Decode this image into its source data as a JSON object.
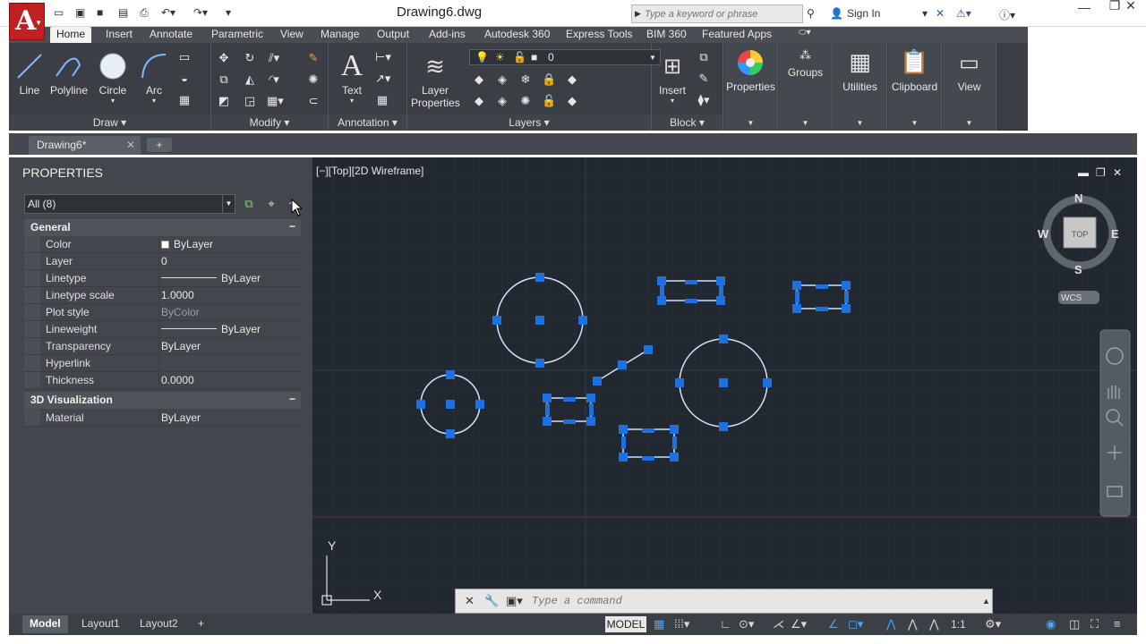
{
  "titlebar": {
    "document_title": "Drawing6.dwg",
    "search_placeholder": "Type a keyword or phrase",
    "sign_in": "Sign In"
  },
  "ribbon": {
    "tabs": [
      "Home",
      "Insert",
      "Annotate",
      "Parametric",
      "View",
      "Manage",
      "Output",
      "Add-ins",
      "Autodesk 360",
      "Express Tools",
      "BIM 360",
      "Featured Apps"
    ],
    "active_tab": "Home",
    "draw": {
      "line": "Line",
      "polyline": "Polyline",
      "circle": "Circle",
      "arc": "Arc",
      "panel": "Draw"
    },
    "modify": {
      "panel": "Modify"
    },
    "annotation": {
      "text": "Text",
      "panel": "Annotation"
    },
    "layers": {
      "layer_properties_1": "Layer",
      "layer_properties_2": "Properties",
      "current_layer": "0",
      "panel": "Layers"
    },
    "block": {
      "insert": "Insert",
      "panel": "Block"
    },
    "properties": "Properties",
    "groups": "Groups",
    "utilities": "Utilities",
    "clipboard": "Clipboard",
    "view": "View"
  },
  "filetabs": {
    "current": "Drawing6*"
  },
  "properties_palette": {
    "title": "PROPERTIES",
    "selection": "All (8)",
    "sections": {
      "general": "General",
      "viz3d": "3D Visualization"
    },
    "general_rows": [
      {
        "name": "Color",
        "value": "ByLayer"
      },
      {
        "name": "Layer",
        "value": "0"
      },
      {
        "name": "Linetype",
        "value": "ByLayer"
      },
      {
        "name": "Linetype scale",
        "value": "1.0000"
      },
      {
        "name": "Plot style",
        "value": "ByColor"
      },
      {
        "name": "Lineweight",
        "value": "ByLayer"
      },
      {
        "name": "Transparency",
        "value": "ByLayer"
      },
      {
        "name": "Hyperlink",
        "value": ""
      },
      {
        "name": "Thickness",
        "value": "0.0000"
      }
    ],
    "viz_rows": [
      {
        "name": "Material",
        "value": "ByLayer"
      }
    ]
  },
  "viewport": {
    "label": "[−][Top][2D Wireframe]",
    "viewcube": {
      "n": "N",
      "s": "S",
      "e": "E",
      "w": "W",
      "top": "TOP",
      "ucs": "WCS"
    },
    "ucs_x": "X",
    "ucs_y": "Y"
  },
  "command_line": {
    "placeholder": "Type a command"
  },
  "statusbar": {
    "layout_tabs": [
      "Model",
      "Layout1",
      "Layout2"
    ],
    "model_button": "MODEL",
    "scale": "1:1"
  },
  "colors": {
    "canvas": "#212830",
    "grip": "#1e6fe0",
    "geometry": "#cfe3ff",
    "palette": "#43474d"
  }
}
